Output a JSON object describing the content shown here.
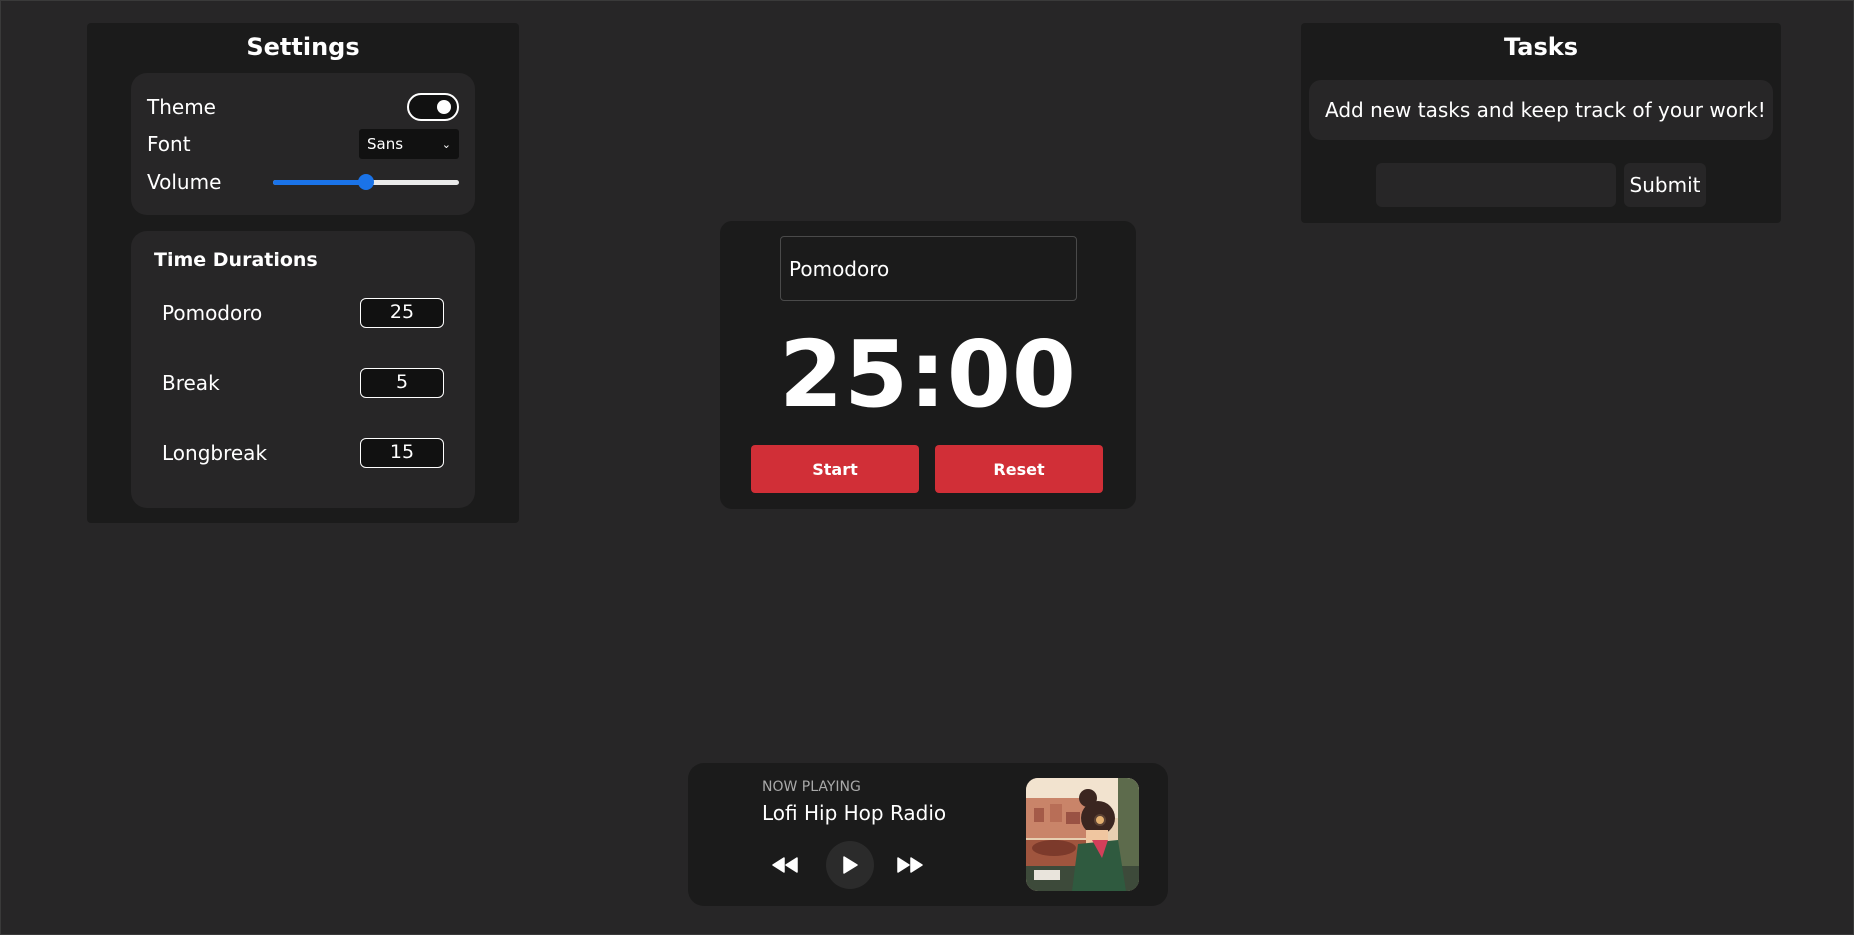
{
  "settings": {
    "title": "Settings",
    "theme_label": "Theme",
    "theme_on": true,
    "font_label": "Font",
    "font_value": "Sans",
    "volume_label": "Volume",
    "volume_level": 0.5,
    "durations": {
      "title": "Time Durations",
      "items": [
        {
          "label": "Pomodoro",
          "value": "25"
        },
        {
          "label": "Break",
          "value": "5"
        },
        {
          "label": "Longbreak",
          "value": "15"
        }
      ]
    }
  },
  "timer": {
    "mode": "Pomodoro",
    "time": "25:00",
    "start_label": "Start",
    "reset_label": "Reset"
  },
  "tasks": {
    "title": "Tasks",
    "message": "Add new tasks and keep track of your work!",
    "input_value": "",
    "submit_label": "Submit"
  },
  "player": {
    "now_playing_label": "NOW PLAYING",
    "track_title": "Lofi Hip Hop Radio",
    "icons": [
      "rewind-icon",
      "play-icon",
      "fast-forward-icon"
    ]
  },
  "colors": {
    "background": "#272627",
    "panel": "#1b1b1b",
    "accent_red": "#d12f37",
    "slider_blue": "#1a73e8"
  }
}
